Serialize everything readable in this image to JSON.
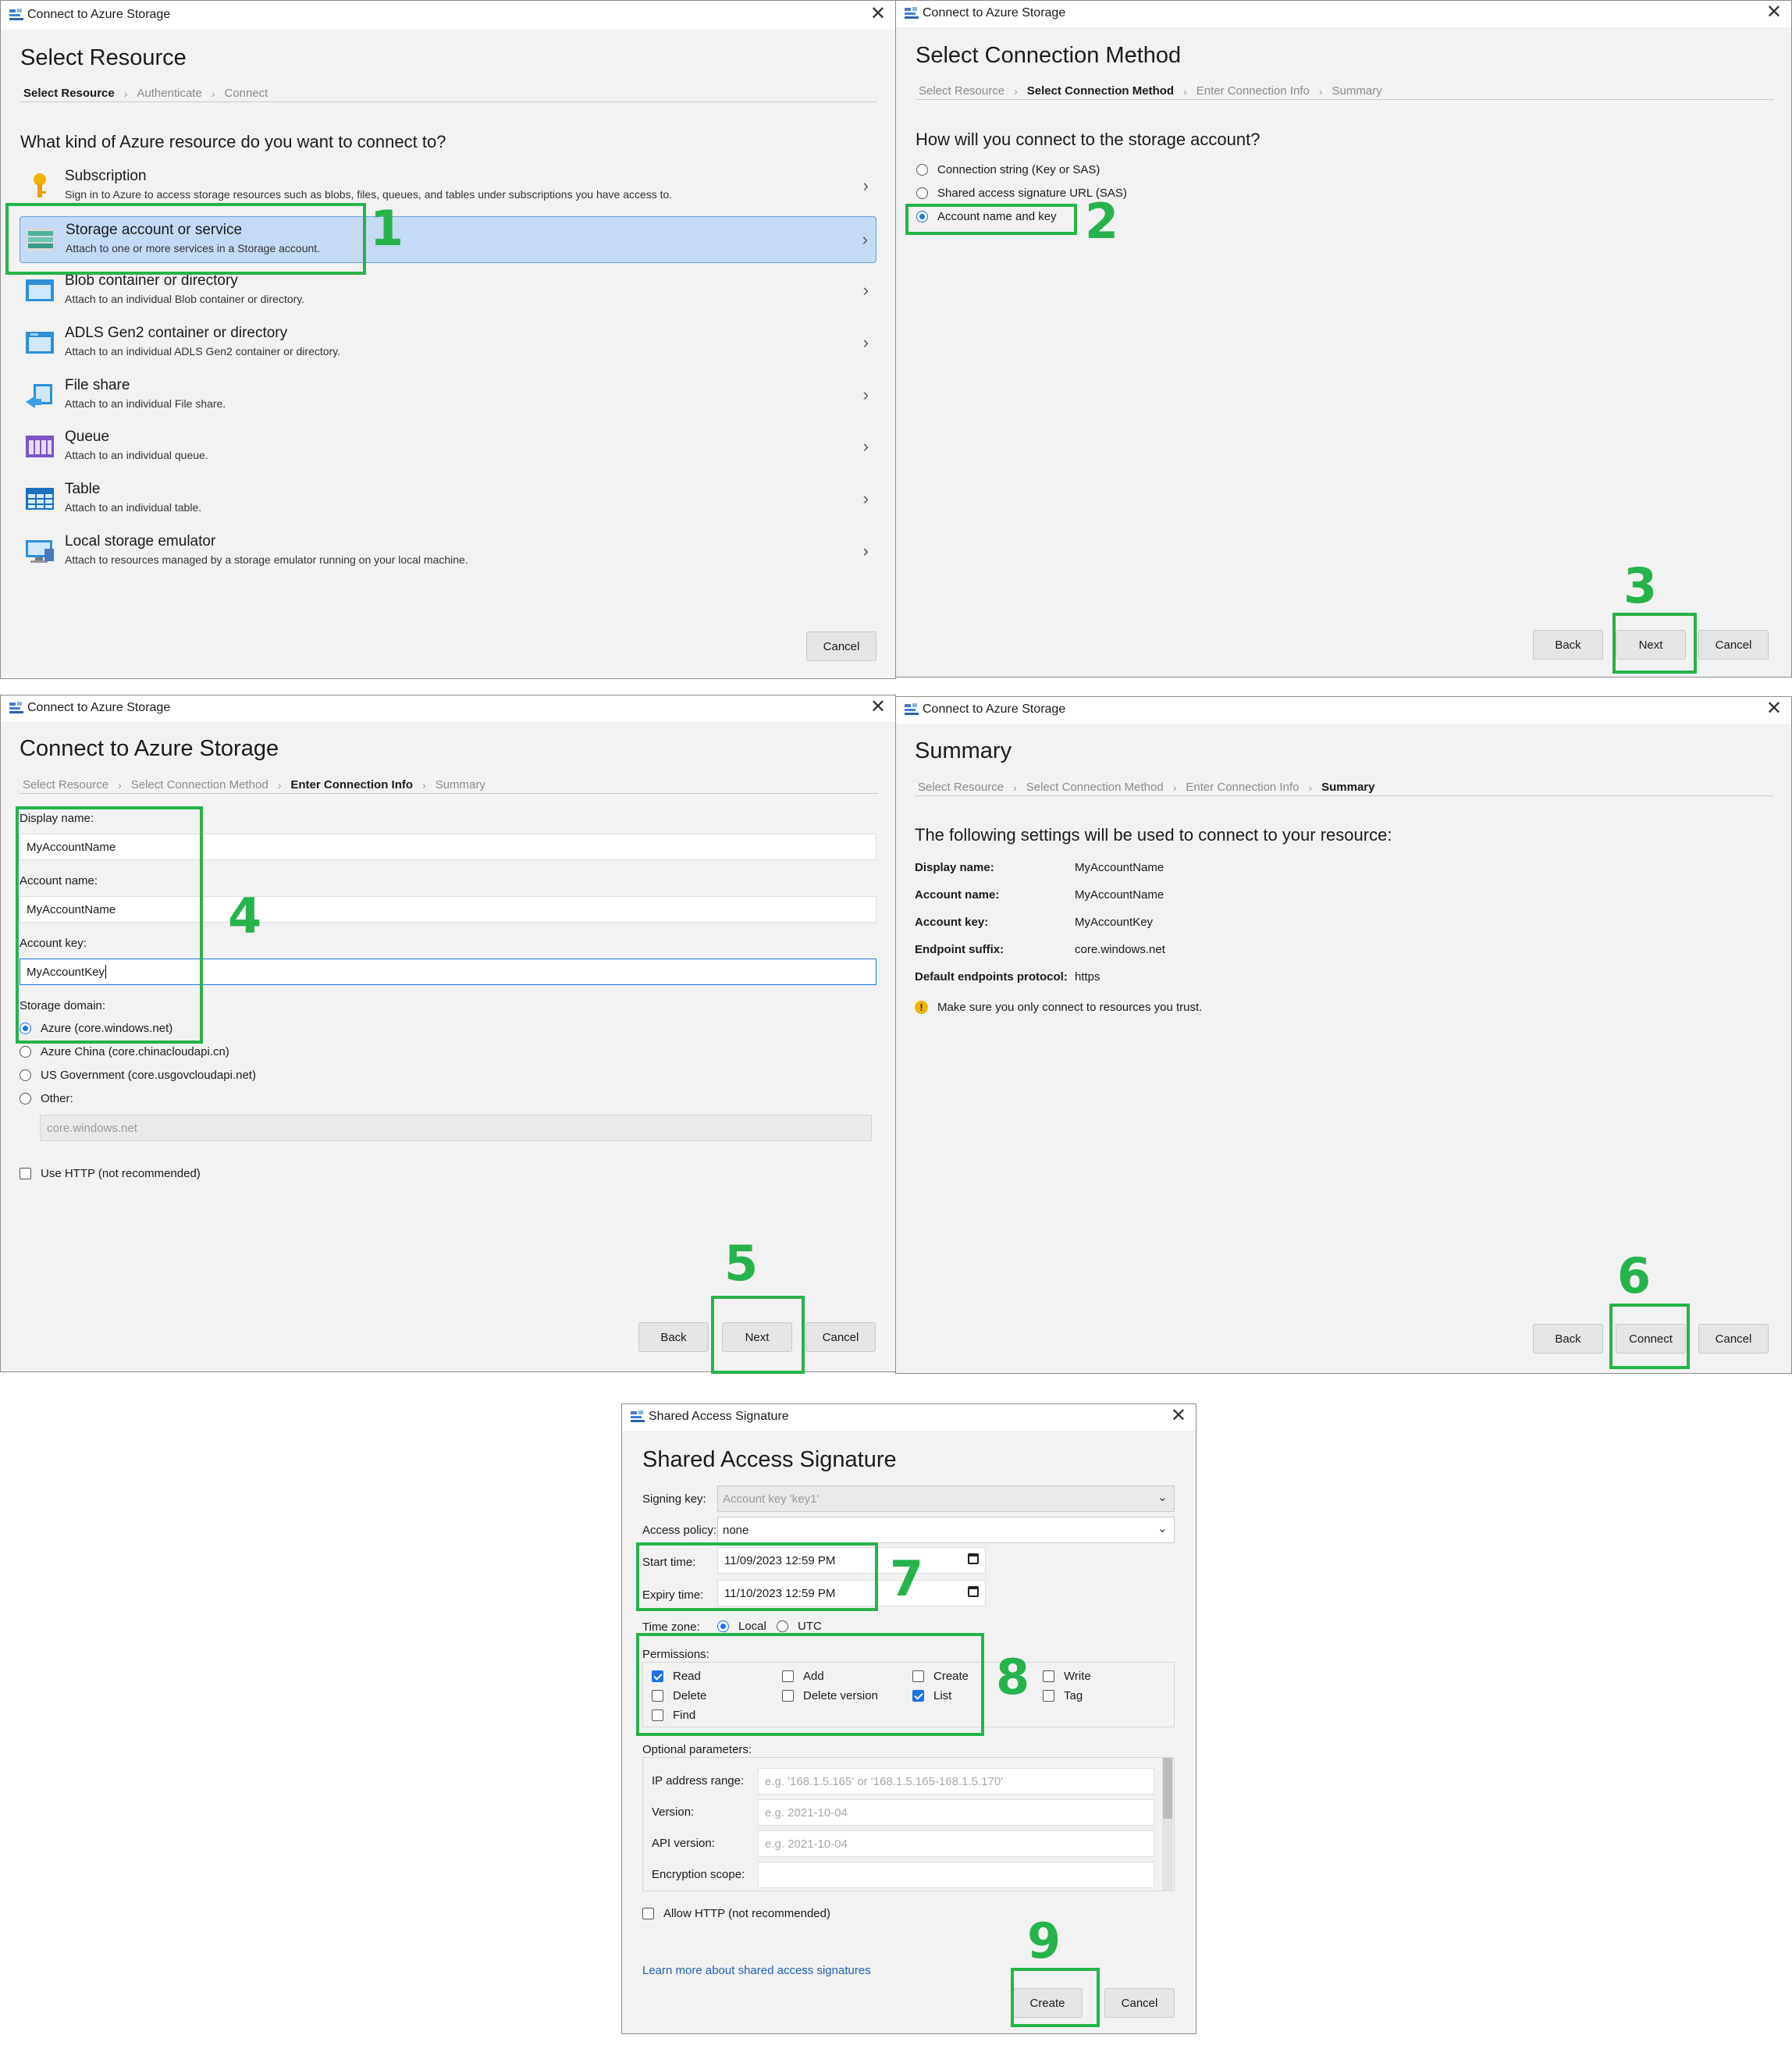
{
  "window_title": "Connect to Azure Storage",
  "common": {
    "back": "Back",
    "next": "Next",
    "cancel": "Cancel",
    "connect": "Connect",
    "create": "Create"
  },
  "p1": {
    "heading": "Select Resource",
    "breadcrumbs": [
      "Select Resource",
      "Authenticate",
      "Connect"
    ],
    "question": "What kind of Azure resource do you want to connect to?",
    "items": [
      {
        "title": "Subscription",
        "desc": "Sign in to Azure to access storage resources such as blobs, files, queues, and tables under subscriptions you have access to.",
        "icon": "key-icon"
      },
      {
        "title": "Storage account or service",
        "desc": "Attach to one or more services in a Storage account.",
        "icon": "storage-account-icon"
      },
      {
        "title": "Blob container or directory",
        "desc": "Attach to an individual Blob container or directory.",
        "icon": "blob-container-icon"
      },
      {
        "title": "ADLS Gen2 container or directory",
        "desc": "Attach to an individual ADLS Gen2 container or directory.",
        "icon": "adls-container-icon"
      },
      {
        "title": "File share",
        "desc": "Attach to an individual File share.",
        "icon": "file-share-icon"
      },
      {
        "title": "Queue",
        "desc": "Attach to an individual queue.",
        "icon": "queue-icon"
      },
      {
        "title": "Table",
        "desc": "Attach to an individual table.",
        "icon": "table-icon"
      },
      {
        "title": "Local storage emulator",
        "desc": "Attach to resources managed by a storage emulator running on your local machine.",
        "icon": "emulator-icon"
      }
    ]
  },
  "p2": {
    "heading": "Select Connection Method",
    "breadcrumbs": [
      "Select Resource",
      "Select Connection Method",
      "Enter Connection Info",
      "Summary"
    ],
    "question": "How will you connect to the storage account?",
    "options": [
      "Connection string (Key or SAS)",
      "Shared access signature URL (SAS)",
      "Account name and key"
    ],
    "selected": "Account name and key"
  },
  "p3": {
    "heading": "Connect to Azure Storage",
    "breadcrumbs": [
      "Select Resource",
      "Select Connection Method",
      "Enter Connection Info",
      "Summary"
    ],
    "display_name_label": "Display name:",
    "display_name_value": "MyAccountName",
    "account_name_label": "Account name:",
    "account_name_value": "MyAccountName",
    "account_key_label": "Account key:",
    "account_key_value": "MyAccountKey",
    "storage_domain_label": "Storage domain:",
    "domains": [
      "Azure (core.windows.net)",
      "Azure China (core.chinacloudapi.cn)",
      "US Government (core.usgovcloudapi.net)",
      "Other:"
    ],
    "other_placeholder": "core.windows.net",
    "use_http": "Use HTTP (not recommended)"
  },
  "p4": {
    "heading": "Summary",
    "breadcrumbs": [
      "Select Resource",
      "Select Connection Method",
      "Enter Connection Info",
      "Summary"
    ],
    "intro": "The following settings will be used to connect to your resource:",
    "rows": [
      {
        "k": "Display name:",
        "v": "MyAccountName"
      },
      {
        "k": "Account name:",
        "v": "MyAccountName"
      },
      {
        "k": "Account key:",
        "v": "MyAccountKey"
      },
      {
        "k": "Endpoint suffix:",
        "v": "core.windows.net"
      },
      {
        "k": "Default endpoints protocol:",
        "v": "https"
      }
    ],
    "warning": "Make sure you only connect to resources you trust."
  },
  "p5": {
    "window_title": "Shared Access Signature",
    "heading": "Shared Access Signature",
    "signing_key_label": "Signing key:",
    "signing_key_value": "Account key 'key1'",
    "access_policy_label": "Access policy:",
    "access_policy_value": "none",
    "start_label": "Start time:",
    "start_value": "11/09/2023  12:59  PM",
    "expiry_label": "Expiry time:",
    "expiry_value": "11/10/2023  12:59  PM",
    "tz_label": "Time zone:",
    "tz_local": "Local",
    "tz_utc": "UTC",
    "permissions_label": "Permissions:",
    "perms": {
      "read": "Read",
      "add": "Add",
      "create": "Create",
      "write": "Write",
      "delete": "Delete",
      "delete_version": "Delete version",
      "list": "List",
      "tag": "Tag",
      "find": "Find"
    },
    "optional_label": "Optional parameters:",
    "ip_label": "IP address range:",
    "ip_placeholder": "e.g. '168.1.5.165' or '168.1.5.165-168.1.5.170'",
    "version_label": "Version:",
    "version_placeholder": "e.g. 2021-10-04",
    "api_label": "API version:",
    "api_placeholder": "e.g. 2021-10-04",
    "scope_label": "Encryption scope:",
    "allow_http": "Allow HTTP (not recommended)",
    "learn_more": "Learn more about shared access signatures"
  },
  "steps": [
    "1",
    "2",
    "3",
    "4",
    "5",
    "6",
    "7",
    "8",
    "9"
  ],
  "colors": {
    "highlight": "#27b34c",
    "accent": "#1a73e8",
    "selection": "#c4daf5"
  }
}
